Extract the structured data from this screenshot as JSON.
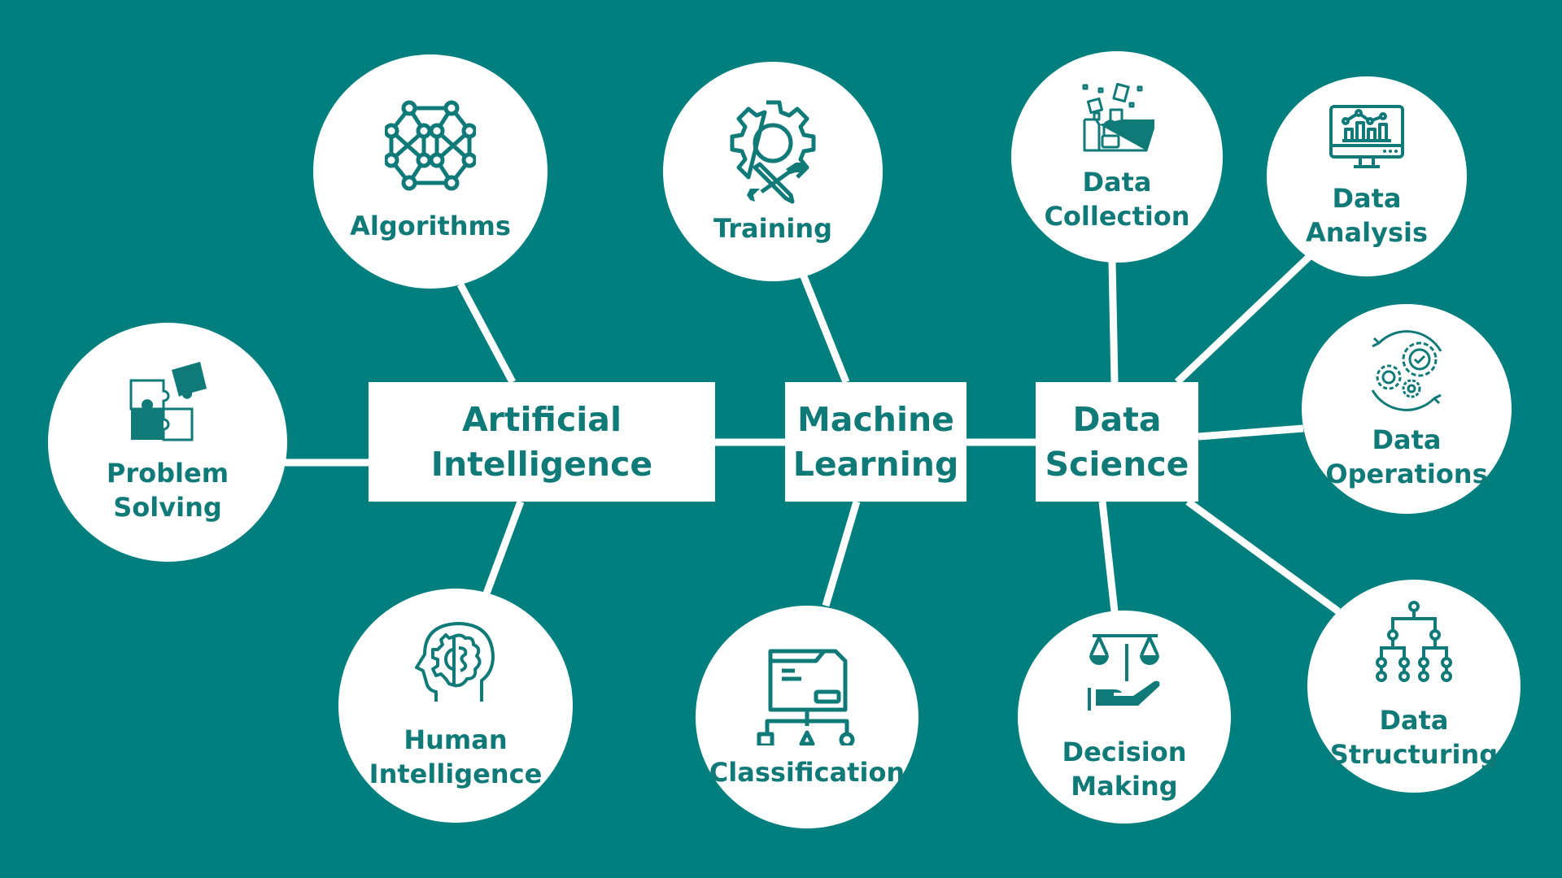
{
  "colors": {
    "background": "#017f7e",
    "foreground": "#ffffff",
    "text": "#0f7a78"
  },
  "hubs": [
    {
      "id": "ai",
      "lines": [
        "Artificial",
        "Intelligence"
      ]
    },
    {
      "id": "ml",
      "lines": [
        "Machine",
        "Learning"
      ]
    },
    {
      "id": "ds",
      "lines": [
        "Data",
        "Science"
      ]
    }
  ],
  "nodes": [
    {
      "id": "problem-solving",
      "hub": "ai",
      "icon": "puzzle-icon",
      "lines": [
        "Problem",
        "Solving"
      ]
    },
    {
      "id": "algorithms",
      "hub": "ai",
      "icon": "network-graph-icon",
      "lines": [
        "Algorithms"
      ]
    },
    {
      "id": "human-intelligence",
      "hub": "ai",
      "icon": "head-brain-gear-icon",
      "lines": [
        "Human",
        "Intelligence"
      ]
    },
    {
      "id": "training",
      "hub": "ml",
      "icon": "gear-pencil-wrench-icon",
      "lines": [
        "Training"
      ]
    },
    {
      "id": "classification",
      "hub": "ml",
      "icon": "folder-hierarchy-shapes-icon",
      "lines": [
        "Classification"
      ]
    },
    {
      "id": "data-collection",
      "hub": "ds",
      "icon": "folder-lock-documents-icon",
      "lines": [
        "Data",
        "Collection"
      ]
    },
    {
      "id": "data-analysis",
      "hub": "ds",
      "icon": "monitor-chart-icon",
      "lines": [
        "Data",
        "Analysis"
      ]
    },
    {
      "id": "data-operations",
      "hub": "ds",
      "icon": "gears-cycle-check-icon",
      "lines": [
        "Data",
        "Operations"
      ]
    },
    {
      "id": "data-structuring",
      "hub": "ds",
      "icon": "tree-hierarchy-icon",
      "lines": [
        "Data",
        "Structuring"
      ]
    },
    {
      "id": "decision-making",
      "hub": "ds",
      "icon": "scale-hand-icon",
      "lines": [
        "Decision",
        "Making"
      ]
    }
  ]
}
